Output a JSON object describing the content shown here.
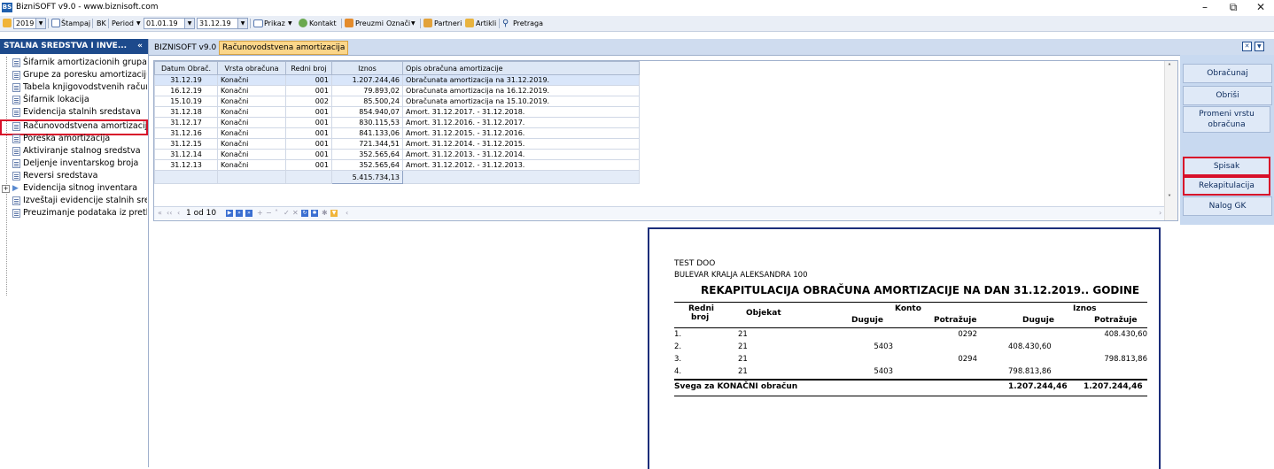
{
  "window": {
    "title": "BizniSOFT v9.0 - www.biznisoft.com",
    "app_icon": "BS"
  },
  "toolbar": {
    "year": "2019",
    "print_label": "Štampaj",
    "bk_label": "BK",
    "period_label": "Period",
    "date_from": "01.01.19",
    "date_to": "31.12.19",
    "prikaz_label": "Prikaz",
    "kontakt_label": "Kontakt",
    "preuzmi_label": "Preuzmi",
    "oznaci_label": "Označi",
    "partneri_label": "Partneri",
    "artikli_label": "Artikli",
    "pretraga_label": "Pretraga"
  },
  "sidebar": {
    "header": "STALNA SREDSTVA I INVE...",
    "collapse": "«",
    "items": [
      {
        "label": "Šifarnik amortizacionih grupa"
      },
      {
        "label": "Grupe za poresku amortizaciju"
      },
      {
        "label": "Tabela knjigovodstvenih računa"
      },
      {
        "label": "Šifarnik lokacija"
      },
      {
        "label": "Evidencija stalnih sredstava"
      },
      {
        "label": "Računovodstvena amortizacija"
      },
      {
        "label": "Poreska amortizacija"
      },
      {
        "label": "Aktiviranje stalnog sredstva"
      },
      {
        "label": "Deljenje inventarskog broja"
      },
      {
        "label": "Reversi sredstava"
      },
      {
        "label": "Evidencija sitnog inventara"
      },
      {
        "label": "Izveštaji evidencije stalnih sredstava"
      },
      {
        "label": "Preuzimanje podataka iz prethodne godine"
      }
    ]
  },
  "tabs": [
    {
      "label": "BIZNISOFT v9.0"
    },
    {
      "label": "Računovodstvena amortizacija"
    }
  ],
  "grid": {
    "columns": [
      "Datum Obrač.",
      "Vrsta obračuna",
      "Redni broj",
      "Iznos",
      "Opis obračuna amortizacije"
    ],
    "rows": [
      [
        "31.12.19",
        "Konačni",
        "001",
        "1.207.244,46",
        "Obračunata amortizacija na 31.12.2019."
      ],
      [
        "16.12.19",
        "Konačni",
        "001",
        "79.893,02",
        "Obračunata amortizacija na 16.12.2019."
      ],
      [
        "15.10.19",
        "Konačni",
        "002",
        "85.500,24",
        "Obračunata amortizacija na 15.10.2019."
      ],
      [
        "31.12.18",
        "Konačni",
        "001",
        "854.940,07",
        "Amort. 31.12.2017. - 31.12.2018."
      ],
      [
        "31.12.17",
        "Konačni",
        "001",
        "830.115,53",
        "Amort. 31.12.2016. - 31.12.2017."
      ],
      [
        "31.12.16",
        "Konačni",
        "001",
        "841.133,06",
        "Amort. 31.12.2015. - 31.12.2016."
      ],
      [
        "31.12.15",
        "Konačni",
        "001",
        "721.344,51",
        "Amort. 31.12.2014. - 31.12.2015."
      ],
      [
        "31.12.14",
        "Konačni",
        "001",
        "352.565,64",
        "Amort. 31.12.2013. - 31.12.2014."
      ],
      [
        "31.12.13",
        "Konačni",
        "001",
        "352.565,64",
        "Amort. 31.12.2012. - 31.12.2013."
      ]
    ],
    "total": "5.415.734,13",
    "pager": "1 od 10"
  },
  "buttons": {
    "obracunaj": "Obračunaj",
    "obrisi": "Obriši",
    "promeni": "Promeni vrstu obračuna",
    "spisak": "Spisak",
    "rekapitulacija": "Rekapitulacija",
    "nalog": "Nalog GK"
  },
  "report": {
    "company": "TEST DOO",
    "address": "BULEVAR KRALJA ALEKSANDRA 100",
    "title": "REKAPITULACIJA OBRAČUNA AMORTIZACIJE NA DAN 31.12.2019.. GODINE",
    "headers": {
      "redni": "Redni",
      "broj": "broj",
      "objekat": "Objekat",
      "konto": "Konto",
      "iznos": "Iznos",
      "duguje": "Duguje",
      "potrazuje": "Potražuje"
    },
    "rows": [
      {
        "rb": "1.",
        "obj": "21",
        "kd": "",
        "kp": "0292",
        "id": "",
        "ip": "408.430,60"
      },
      {
        "rb": "2.",
        "obj": "21",
        "kd": "5403",
        "kp": "",
        "id": "408.430,60",
        "ip": ""
      },
      {
        "rb": "3.",
        "obj": "21",
        "kd": "",
        "kp": "0294",
        "id": "",
        "ip": "798.813,86"
      },
      {
        "rb": "4.",
        "obj": "21",
        "kd": "5403",
        "kp": "",
        "id": "798.813,86",
        "ip": ""
      }
    ],
    "total_label": "Svega za KONAČNI obračun",
    "total_duguje": "1.207.244,46",
    "total_potrazuje": "1.207.244,46"
  },
  "colors": {
    "accent_blue": "#1d4a8c",
    "tab_active": "#fbd68a",
    "highlight_red": "#d8102a",
    "report_border": "#1b2d7a"
  }
}
